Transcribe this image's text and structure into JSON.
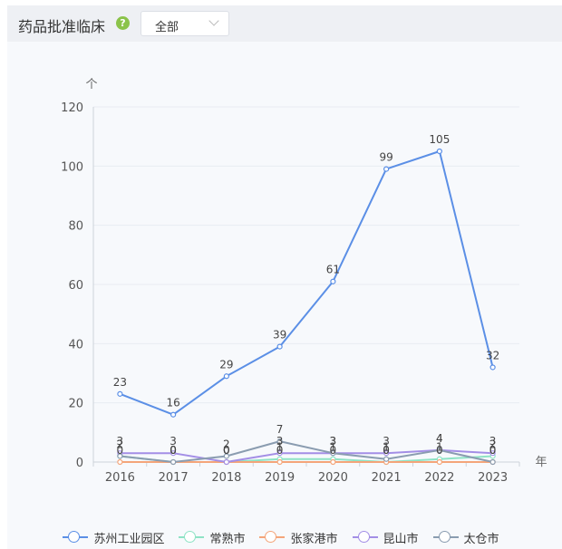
{
  "header": {
    "title": "药品批准临床",
    "help_symbol": "?",
    "filter_value": "全部"
  },
  "chart_data": {
    "type": "line",
    "xlabel": "年",
    "ylabel": "个",
    "categories": [
      "2016",
      "2017",
      "2018",
      "2019",
      "2020",
      "2021",
      "2022",
      "2023"
    ],
    "ylim": [
      0,
      120
    ],
    "yticks": [
      0,
      20,
      40,
      60,
      80,
      100,
      120
    ],
    "grid": true,
    "legend": "bottom",
    "series": [
      {
        "name": "苏州工业园区",
        "color": "#5b8fe6",
        "values": [
          23,
          16,
          29,
          39,
          61,
          99,
          105,
          32
        ]
      },
      {
        "name": "常熟市",
        "color": "#8ee3c5",
        "values": [
          2,
          0,
          0,
          1,
          1,
          0,
          1,
          2
        ]
      },
      {
        "name": "张家港市",
        "color": "#f4a57a",
        "values": [
          0,
          0,
          0,
          0,
          0,
          0,
          0,
          0
        ]
      },
      {
        "name": "昆山市",
        "color": "#a38ee6",
        "values": [
          3,
          3,
          0,
          3,
          3,
          3,
          4,
          3
        ]
      },
      {
        "name": "太仓市",
        "color": "#8a9cb0",
        "values": [
          2,
          0,
          2,
          7,
          3,
          1,
          4,
          0
        ]
      }
    ]
  }
}
